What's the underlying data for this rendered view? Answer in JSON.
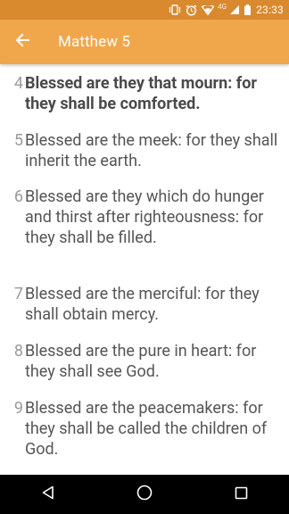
{
  "status_bar": {
    "network": "4G",
    "time": "23:33",
    "icons": [
      "vibrate-icon",
      "alarm-icon",
      "wifi-icon",
      "signal-icon",
      "battery-icon"
    ]
  },
  "app_bar": {
    "title": "Matthew 5",
    "back_icon": "back-arrow-icon"
  },
  "verses": [
    {
      "num": "4",
      "text": "Blessed are they that mourn: for they shall be comforted.",
      "highlighted": true
    },
    {
      "num": "5",
      "text": "Blessed are the meek: for they shall inherit the earth.",
      "highlighted": false
    },
    {
      "num": "6",
      "text": "Blessed are they which do hunger and thirst after righteousness: for they shall be filled.",
      "highlighted": false
    },
    {
      "num": "7",
      "text": "Blessed are the merciful: for they shall obtain mercy.",
      "highlighted": false
    },
    {
      "num": "8",
      "text": "Blessed are the pure in heart: for they shall see God.",
      "highlighted": false
    },
    {
      "num": "9",
      "text": "Blessed are the peacemakers: for they shall be called the children of God.",
      "highlighted": false
    }
  ],
  "nav_bar": {
    "icons": [
      "back-triangle-icon",
      "home-circle-icon",
      "recents-square-icon"
    ]
  },
  "colors": {
    "status_bar": "#d98a2e",
    "app_bar": "#f0a74b",
    "verse_text": "#555555",
    "verse_number": "#9a9a9a"
  }
}
